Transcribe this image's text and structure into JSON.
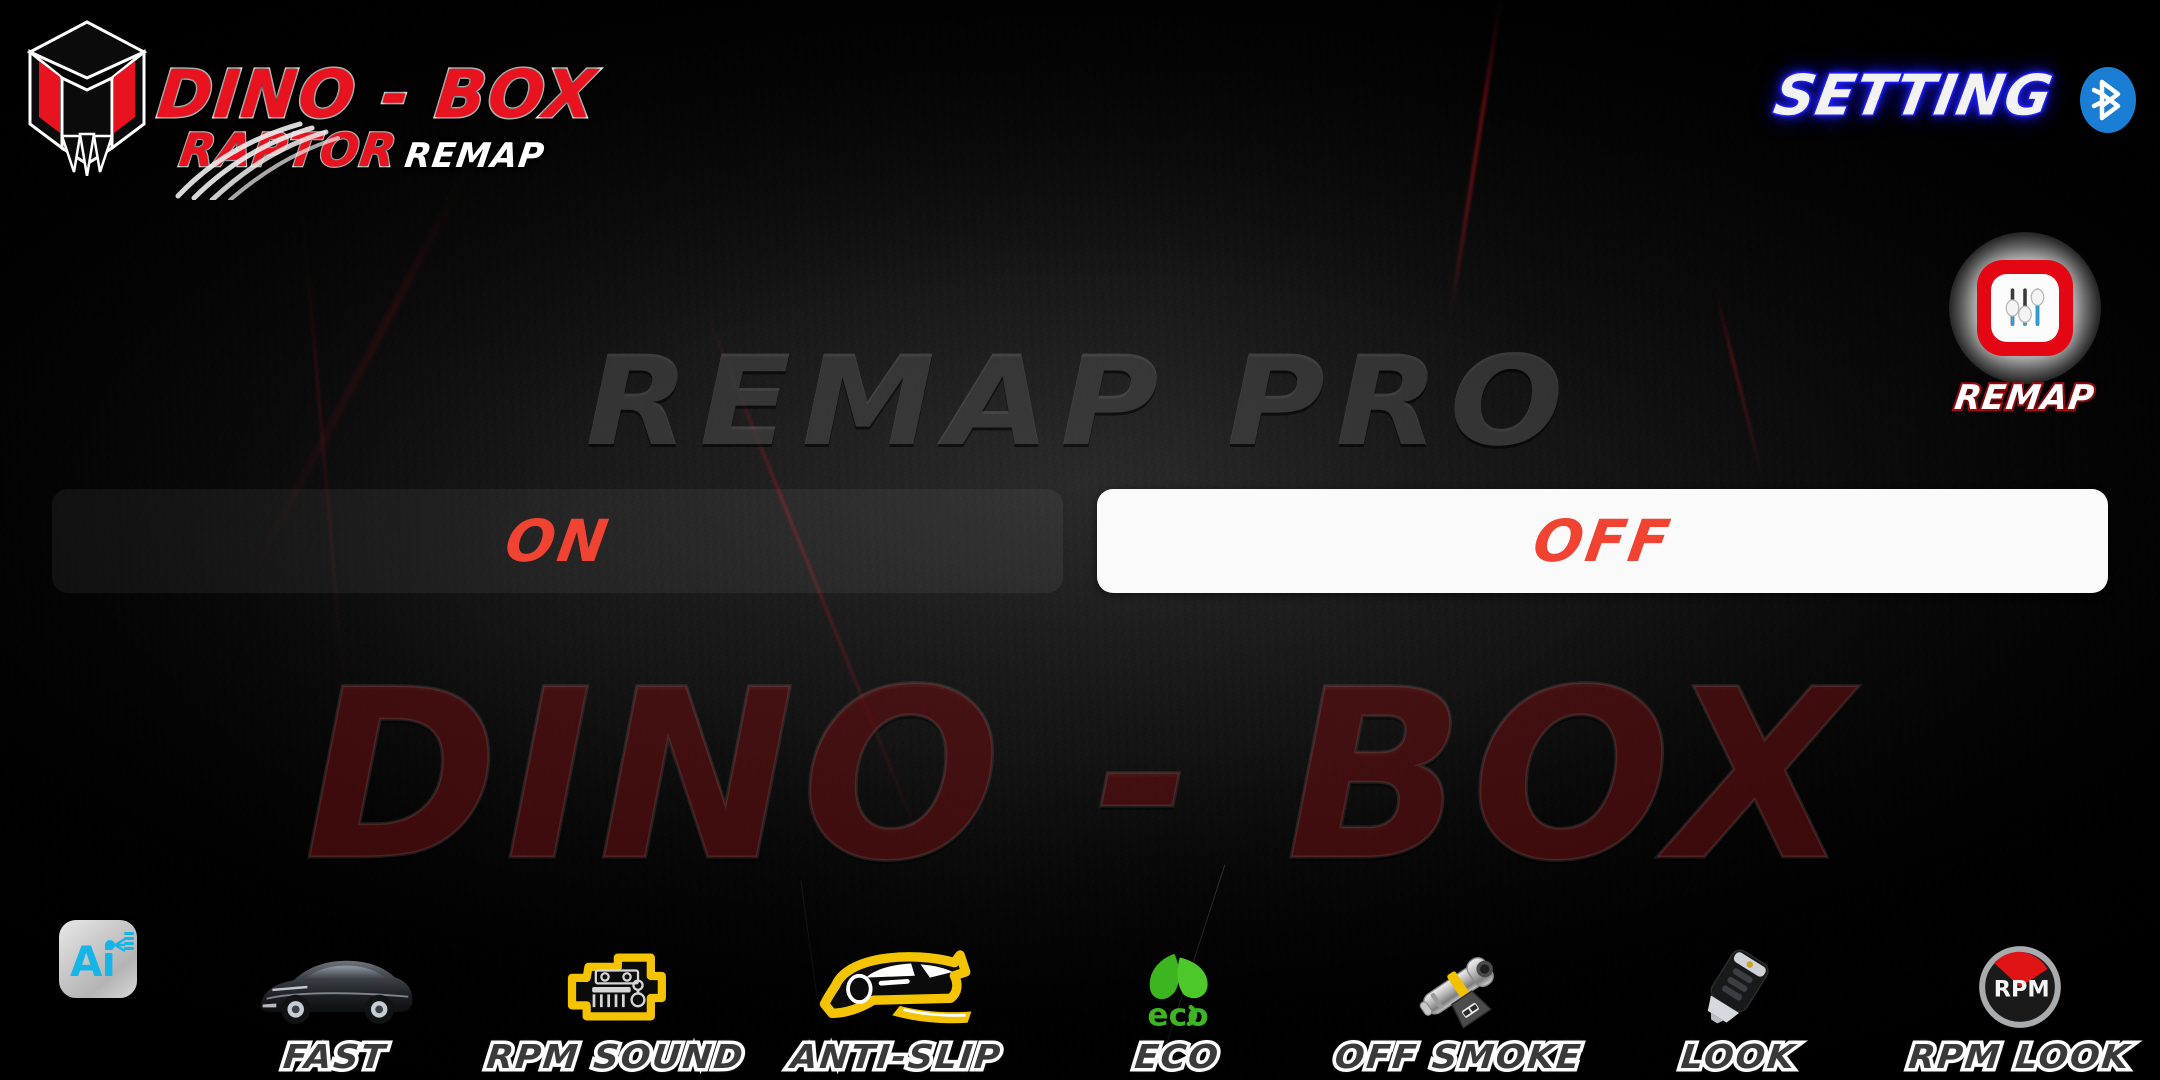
{
  "app": {
    "brand_primary": "DINO - BOX",
    "brand_sub": "RAPTOR",
    "brand_suffix": "REMAP",
    "watermark_center": "REMAP PRO",
    "watermark_bottom": "DINO - BOX",
    "colors": {
      "brand_red": "#e8131e",
      "accent_red": "#f04332",
      "setting_blue": "#1a1aff",
      "bluetooth_blue": "#1a7fd4",
      "icon_yellow": "#f5c400",
      "eco_green": "#3cb521",
      "panel_white": "#fafafa",
      "background": "#0a0a0a"
    }
  },
  "header": {
    "setting_label": "SETTING",
    "bluetooth_icon": "bluetooth-icon",
    "logo_icon": "dino-box-logo-icon"
  },
  "remap_button": {
    "caption": "REMAP",
    "icon": "equalizer-sliders-icon"
  },
  "toggle": {
    "on_label": "ON",
    "off_label": "OFF",
    "selected": "OFF"
  },
  "bottom_nav": {
    "items": [
      {
        "label": "",
        "icon": "ai-assistant-icon",
        "name": "ai"
      },
      {
        "label": "FAST",
        "icon": "sports-car-icon",
        "name": "fast"
      },
      {
        "label": "RPM SOUND",
        "icon": "engine-icon",
        "name": "rpm-sound"
      },
      {
        "label": "ANTI-SLIP",
        "icon": "drifting-car-icon",
        "name": "anti-slip"
      },
      {
        "label": "ECO",
        "icon": "eco-leaf-icon",
        "name": "eco"
      },
      {
        "label": "OFF SMOKE",
        "icon": "fuel-injector-icon",
        "name": "off-smoke"
      },
      {
        "label": "LOOK",
        "icon": "car-key-icon",
        "name": "look"
      },
      {
        "label": "RPM LOOK",
        "icon": "rpm-gauge-icon",
        "name": "rpm-look"
      }
    ]
  }
}
